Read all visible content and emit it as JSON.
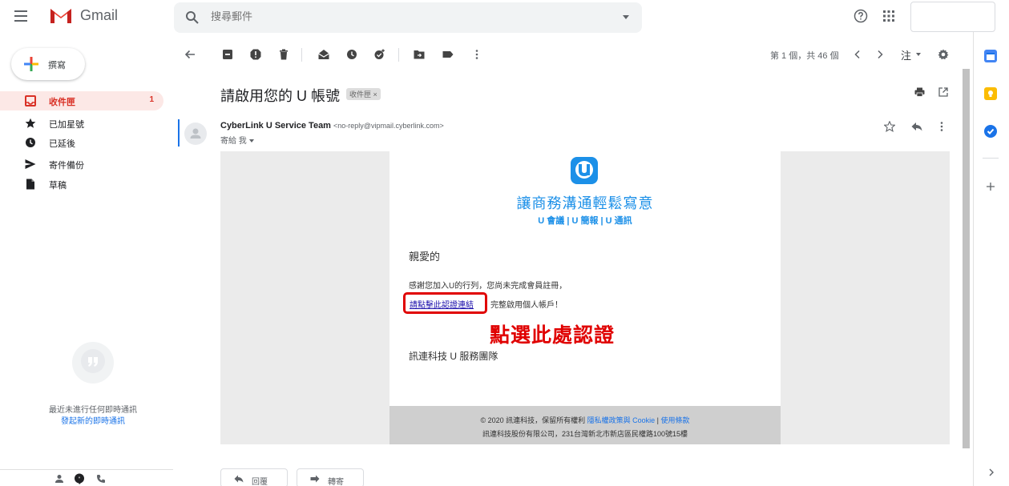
{
  "topbar": {
    "app_name": "Gmail",
    "search_placeholder": "搜尋郵件"
  },
  "nav": {
    "compose_label": "撰寫",
    "items": [
      {
        "label": "收件匣",
        "count": "1"
      },
      {
        "label": "已加星號"
      },
      {
        "label": "已延後"
      },
      {
        "label": "寄件備份"
      },
      {
        "label": "草稿"
      }
    ]
  },
  "hangouts": {
    "empty_text": "最近未進行任何即時通訊",
    "start_link": "發起新的即時通訊"
  },
  "toolbar": {
    "pager": "第 1 個，共 46 個",
    "lang_label": "注"
  },
  "message": {
    "subject": "請啟用您的 U 帳號",
    "label_chip": "收件匣 ×",
    "sender_name": "CyberLink U Service Team",
    "sender_email": "<no-reply@vipmail.cyberlink.com>",
    "to": "寄給 我"
  },
  "email_body": {
    "tagline": "讓商務溝通輕鬆寫意",
    "subline": "U 會議 | U 簡報 | U 通訊",
    "greeting": "親愛的",
    "thanks": "感謝您加入U的行列，您尚未完成會員註冊，",
    "verify_link": "請點擊此認證連結",
    "verify_tail": "完整啟用個人帳戶！",
    "callout": "點選此處認證",
    "signoff": "訊連科技 U 服務團隊",
    "footer_copyright": "© 2020 訊連科技，保留所有權利",
    "footer_privacy": "隱私權政策與 Cookie",
    "footer_sep": "|",
    "footer_terms": "使用條款",
    "footer_address": "訊連科技股份有限公司，231台灣新北市新店區民權路100號15樓"
  },
  "actions": {
    "reply": "回覆",
    "forward": "轉寄"
  },
  "colors": {
    "gmail_red": "#d93025",
    "brand_blue": "#1c90e8",
    "callout_red": "#e00000"
  }
}
